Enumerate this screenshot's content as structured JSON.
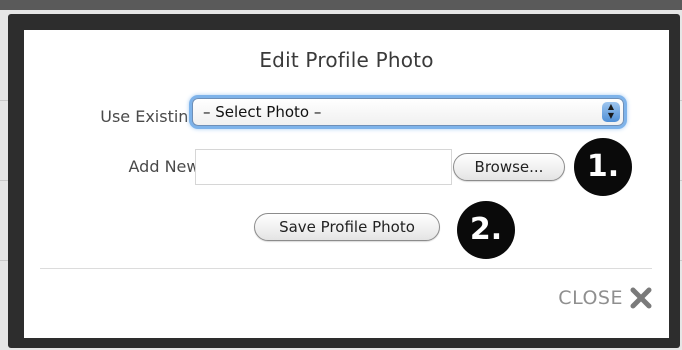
{
  "dialog": {
    "title": "Edit Profile Photo",
    "use_existing_label": "Use Existing:",
    "select_value": "– Select Photo –",
    "add_new_label": "Add New:",
    "file_input_value": "",
    "browse_label": "Browse...",
    "save_label": "Save Profile Photo",
    "close_label": "CLOSE"
  },
  "badges": {
    "step1": "1.",
    "step2": "2."
  },
  "icons": {
    "close": "close-x-icon",
    "select_arrows": "updown-arrows-icon"
  },
  "colors": {
    "focus_ring": "#7eb3ea",
    "badge_bg": "#0a0a0a",
    "overlay_frame": "#2d2d2d",
    "close_text": "#8f8f8f"
  }
}
